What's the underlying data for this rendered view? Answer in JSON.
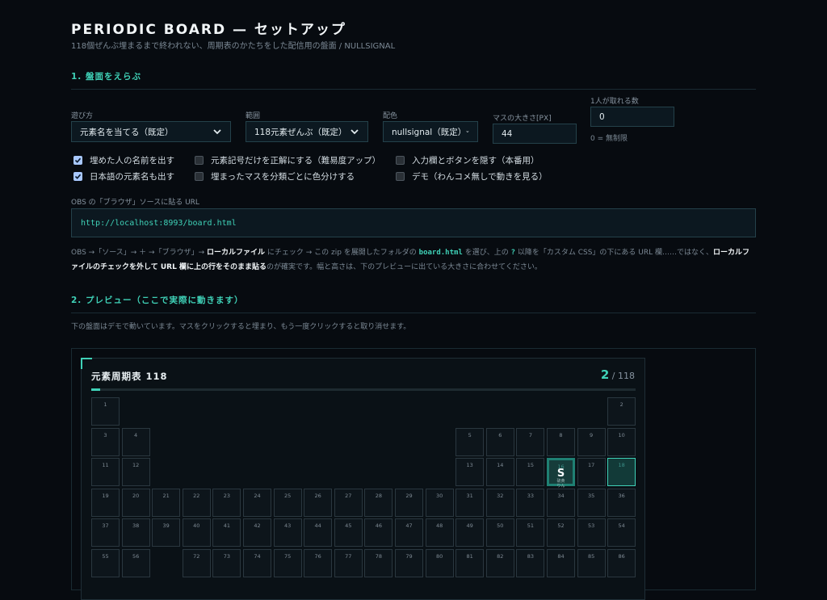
{
  "header": {
    "title": "PERIODIC BOARD — セットアップ",
    "subtitle": "118個ぜんぶ埋まるまで終われない、周期表のかたちをした配信用の盤面 / NULLSIGNAL"
  },
  "section1": {
    "title": "1. 盤面をえらぶ",
    "play_mode": {
      "label": "遊び方",
      "value": "元素名を当てる（既定）"
    },
    "range": {
      "label": "範囲",
      "value": "118元素ぜんぶ（既定）"
    },
    "palette": {
      "label": "配色",
      "value": "nullsignal（既定）"
    },
    "cell_size": {
      "label": "マスの大きさ[PX]",
      "value": "44"
    },
    "per_person": {
      "label": "1人が取れる数",
      "value": "0",
      "hint": "0 = 無制限"
    },
    "checkboxes": [
      {
        "label": "埋めた人の名前を出す",
        "checked": true
      },
      {
        "label": "日本語の元素名も出す",
        "checked": true
      },
      {
        "label": "元素記号だけを正解にする（難易度アップ）",
        "checked": false
      },
      {
        "label": "埋まったマスを分類ごとに色分けする",
        "checked": false
      },
      {
        "label": "入力欄とボタンを隠す（本番用）",
        "checked": false
      },
      {
        "label": "デモ（わんコメ無しで動きを見る）",
        "checked": false
      }
    ],
    "obs_label": "OBS の「ブラウザ」ソースに貼る URL",
    "obs_url": "http://localhost:8993/board.html",
    "desc": {
      "p1": "OBS →「ソース」→ ＋ →「ブラウザ」→ ",
      "b1": "ローカルファイル",
      "p2": " にチェック → この zip を展開したフォルダの ",
      "m1": "board.html",
      "p3": " を選び、上の ",
      "q": "?",
      "p4": " 以降を「カスタム CSS」の下にある URL 欄……ではなく、",
      "b2": "ローカルファイルのチェックを外して URL 欄に上の行をそのまま貼る",
      "p5": "のが確実です。幅と高さは、下のプレビューに出ている大きさに合わせてください。"
    }
  },
  "section2": {
    "title": "2. プレビュー（ここで実際に動きます）",
    "note": "下の盤面はデモで動いています。マスをクリックすると埋まり、もう一度クリックすると取り消せます。"
  },
  "board": {
    "title": "元素周期表 118",
    "filled_count": "2",
    "total_label": "/ 118",
    "progress": 0.017,
    "cells": [
      {
        "n": "1",
        "col": 1,
        "row": 1
      },
      {
        "n": "2",
        "col": 18,
        "row": 1
      },
      {
        "n": "3",
        "col": 1,
        "row": 2
      },
      {
        "n": "4",
        "col": 2,
        "row": 2
      },
      {
        "n": "5",
        "col": 13,
        "row": 2
      },
      {
        "n": "6",
        "col": 14,
        "row": 2
      },
      {
        "n": "7",
        "col": 15,
        "row": 2
      },
      {
        "n": "8",
        "col": 16,
        "row": 2
      },
      {
        "n": "9",
        "col": 17,
        "row": 2
      },
      {
        "n": "10",
        "col": 18,
        "row": 2
      },
      {
        "n": "11",
        "col": 1,
        "row": 3
      },
      {
        "n": "12",
        "col": 2,
        "row": 3
      },
      {
        "n": "13",
        "col": 13,
        "row": 3
      },
      {
        "n": "14",
        "col": 14,
        "row": 3
      },
      {
        "n": "15",
        "col": 15,
        "row": 3
      },
      {
        "n": "16",
        "col": 16,
        "row": 3,
        "filled": true,
        "big": true,
        "sym": "S",
        "jp1": "硫黄",
        "jp2": "りん"
      },
      {
        "n": "17",
        "col": 17,
        "row": 3
      },
      {
        "n": "18",
        "col": 18,
        "row": 3,
        "filled": true
      },
      {
        "n": "19",
        "col": 1,
        "row": 4
      },
      {
        "n": "20",
        "col": 2,
        "row": 4
      },
      {
        "n": "21",
        "col": 3,
        "row": 4
      },
      {
        "n": "22",
        "col": 4,
        "row": 4
      },
      {
        "n": "23",
        "col": 5,
        "row": 4
      },
      {
        "n": "24",
        "col": 6,
        "row": 4
      },
      {
        "n": "25",
        "col": 7,
        "row": 4
      },
      {
        "n": "26",
        "col": 8,
        "row": 4
      },
      {
        "n": "27",
        "col": 9,
        "row": 4
      },
      {
        "n": "28",
        "col": 10,
        "row": 4
      },
      {
        "n": "29",
        "col": 11,
        "row": 4
      },
      {
        "n": "30",
        "col": 12,
        "row": 4
      },
      {
        "n": "31",
        "col": 13,
        "row": 4
      },
      {
        "n": "32",
        "col": 14,
        "row": 4
      },
      {
        "n": "33",
        "col": 15,
        "row": 4
      },
      {
        "n": "34",
        "col": 16,
        "row": 4
      },
      {
        "n": "35",
        "col": 17,
        "row": 4
      },
      {
        "n": "36",
        "col": 18,
        "row": 4
      },
      {
        "n": "37",
        "col": 1,
        "row": 5
      },
      {
        "n": "38",
        "col": 2,
        "row": 5
      },
      {
        "n": "39",
        "col": 3,
        "row": 5
      },
      {
        "n": "40",
        "col": 4,
        "row": 5
      },
      {
        "n": "41",
        "col": 5,
        "row": 5
      },
      {
        "n": "42",
        "col": 6,
        "row": 5
      },
      {
        "n": "43",
        "col": 7,
        "row": 5
      },
      {
        "n": "44",
        "col": 8,
        "row": 5
      },
      {
        "n": "45",
        "col": 9,
        "row": 5
      },
      {
        "n": "46",
        "col": 10,
        "row": 5
      },
      {
        "n": "47",
        "col": 11,
        "row": 5
      },
      {
        "n": "48",
        "col": 12,
        "row": 5
      },
      {
        "n": "49",
        "col": 13,
        "row": 5
      },
      {
        "n": "50",
        "col": 14,
        "row": 5
      },
      {
        "n": "51",
        "col": 15,
        "row": 5
      },
      {
        "n": "52",
        "col": 16,
        "row": 5
      },
      {
        "n": "53",
        "col": 17,
        "row": 5
      },
      {
        "n": "54",
        "col": 18,
        "row": 5
      },
      {
        "n": "55",
        "col": 1,
        "row": 6
      },
      {
        "n": "56",
        "col": 2,
        "row": 6
      },
      {
        "n": "72",
        "col": 4,
        "row": 6
      },
      {
        "n": "73",
        "col": 5,
        "row": 6
      },
      {
        "n": "74",
        "col": 6,
        "row": 6
      },
      {
        "n": "75",
        "col": 7,
        "row": 6
      },
      {
        "n": "76",
        "col": 8,
        "row": 6
      },
      {
        "n": "77",
        "col": 9,
        "row": 6
      },
      {
        "n": "78",
        "col": 10,
        "row": 6
      },
      {
        "n": "79",
        "col": 11,
        "row": 6
      },
      {
        "n": "80",
        "col": 12,
        "row": 6
      },
      {
        "n": "81",
        "col": 13,
        "row": 6
      },
      {
        "n": "82",
        "col": 14,
        "row": 6
      },
      {
        "n": "83",
        "col": 15,
        "row": 6
      },
      {
        "n": "84",
        "col": 16,
        "row": 6
      },
      {
        "n": "85",
        "col": 17,
        "row": 6
      },
      {
        "n": "86",
        "col": 18,
        "row": 6
      }
    ]
  },
  "colors": {
    "accent": "#3fd1b7",
    "background": "#070b10",
    "checkbox_checked": "#a8c8ff"
  }
}
